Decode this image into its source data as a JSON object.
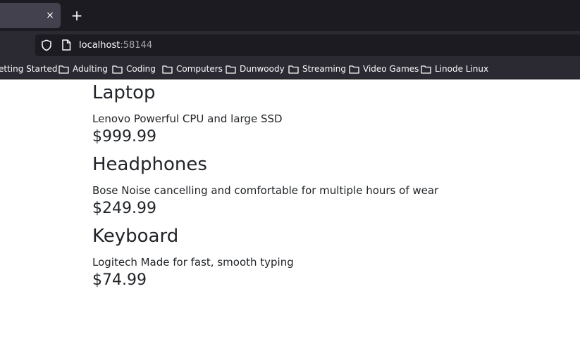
{
  "browser": {
    "tab": {
      "close_glyph": "×"
    },
    "new_tab_glyph": "+",
    "url": {
      "host": "localhost",
      "port": ":58144"
    },
    "bookmarks": [
      {
        "label": "etting Started",
        "icon": "none"
      },
      {
        "label": "Adulting",
        "icon": "folder-icon"
      },
      {
        "label": "Coding",
        "icon": "folder-icon"
      },
      {
        "label": "Computers",
        "icon": "folder-icon"
      },
      {
        "label": "Dunwoody",
        "icon": "folder-icon"
      },
      {
        "label": "Streaming",
        "icon": "folder-icon"
      },
      {
        "label": "Video Games",
        "icon": "folder-icon"
      },
      {
        "label": "Linode Linux",
        "icon": "folder-icon"
      }
    ]
  },
  "products": [
    {
      "name": "Laptop",
      "description": "Lenovo Powerful CPU and large SSD",
      "price": "$999.99"
    },
    {
      "name": "Headphones",
      "description": "Bose Noise cancelling and comfortable for multiple hours of wear",
      "price": "$249.99"
    },
    {
      "name": "Keyboard",
      "description": "Logitech Made for fast, smooth typing",
      "price": "$74.99"
    }
  ],
  "colors": {
    "tabstrip": "#1c1b22",
    "toolbar": "#2b2a33",
    "text": "#212529"
  }
}
